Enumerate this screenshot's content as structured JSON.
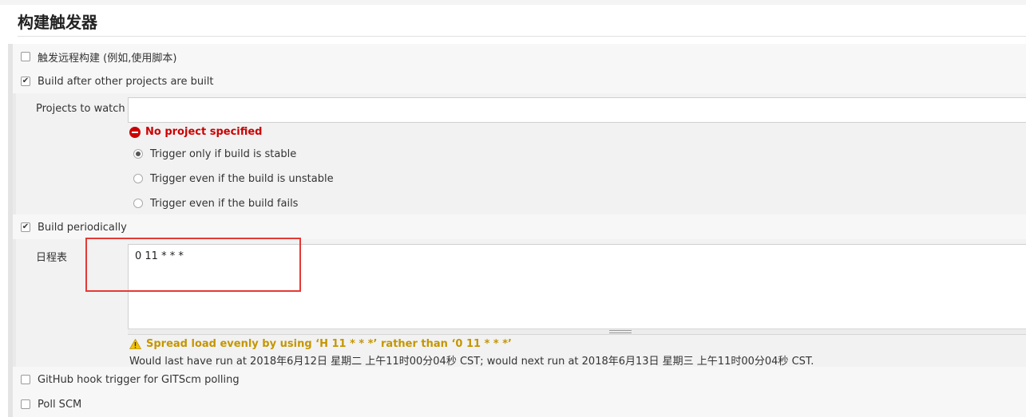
{
  "page_title": "构建触发器",
  "triggers": {
    "remote": {
      "label": "触发远程构建 (例如,使用脚本)",
      "checked": false
    },
    "after_other": {
      "label": "Build after other projects are built",
      "checked": true
    },
    "periodic": {
      "label": "Build periodically",
      "checked": true
    },
    "github_hook": {
      "label": "GitHub hook trigger for GITScm polling",
      "checked": false
    },
    "poll_scm": {
      "label": "Poll SCM",
      "checked": false
    }
  },
  "projects_to_watch": {
    "label": "Projects to watch",
    "value": "",
    "error": "No project specified"
  },
  "trigger_options": [
    {
      "label": "Trigger only if build is stable",
      "selected": true
    },
    {
      "label": "Trigger even if the build is unstable",
      "selected": false
    },
    {
      "label": "Trigger even if the build fails",
      "selected": false
    }
  ],
  "schedule": {
    "label": "日程表",
    "value": "0 11 * * *",
    "warning": "Spread load evenly by using ‘H 11 * * *’ rather than ‘0 11 * * *’",
    "info": "Would last have run at 2018年6月12日 星期二 上午11时00分04秒 CST; would next run at 2018年6月13日 星期三 上午11时00分04秒 CST."
  },
  "colors": {
    "error": "#cc0000",
    "warning": "#c59600",
    "highlight": "#e53935"
  }
}
